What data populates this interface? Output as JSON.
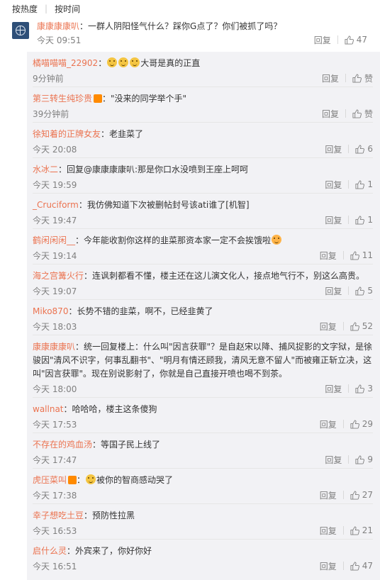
{
  "tabs": {
    "hot": "按热度",
    "time": "按时间"
  },
  "main": {
    "user": "康康康康叭",
    "text": "：一群人阴阳怪气什么？踩你G点了？你们被抓了吗？",
    "time": "今天 09:51",
    "reply_label": "回复",
    "likes": "47"
  },
  "replies": [
    {
      "user": "橘喵喵喵_22902",
      "emojis": 3,
      "text": "大哥是真的正直",
      "time": "9分钟前",
      "reply_label": "回复",
      "likes": "赞"
    },
    {
      "user": "第三转生纯珍贵",
      "badge": true,
      "text": "：\"没来的同学举个手\"",
      "time": "39分钟前",
      "reply_label": "回复",
      "likes": "赞"
    },
    {
      "user": "徐知着的正牌女友",
      "text": "：老韭菜了",
      "time": "今天 20:08",
      "reply_label": "回复",
      "likes": "6"
    },
    {
      "user": "水冰二",
      "text": "：回复@康康康康叭:那是你口水没喷到王座上呵呵",
      "time": "今天 19:59",
      "reply_label": "回复",
      "likes": "1"
    },
    {
      "user": "_Cruciform",
      "text": "：我仿佛知道下次被删帖封号该ati谁了[机智]",
      "time": "今天 19:47",
      "reply_label": "回复",
      "likes": "1"
    },
    {
      "user": "鹤闲闲闲__",
      "text": "：今年能收割你这样的韭菜那资本家一定不会挨饿啦",
      "emoji_after": true,
      "time": "今天 19:14",
      "reply_label": "回复",
      "likes": "11"
    },
    {
      "user": "海之宫篝火行",
      "text": "：连讽刺都看不懂，楼主还在这儿演文化人，接点地气行不，别这么高贵。",
      "time": "今天 19:07",
      "reply_label": "回复",
      "likes": "5"
    },
    {
      "user": "Miko870",
      "text": "：长势不错的韭菜，啊不，已经韭黄了",
      "time": "今天 18:03",
      "reply_label": "回复",
      "likes": "52"
    },
    {
      "user": "康康康康叭",
      "text": "：统一回复楼上：什么叫\"因言获罪\"？是自赵宋以降、捕风捉影的文字狱，是徐骏因\"清风不识字，何事乱翻书\"、\"明月有情还顾我，清风无意不留人\"而被雍正斩立决，这叫\"因言获罪\"。现在别说影射了，你就是自己直接开喷也喝不到茶。",
      "time": "今天 18:00",
      "reply_label": "回复",
      "likes": "3"
    },
    {
      "user": "wallnat",
      "text": "：哈哈哈，楼主这条傻狗",
      "time": "今天 17:53",
      "reply_label": "回复",
      "likes": "29"
    },
    {
      "user": "不存在的鸡血汤",
      "text": "：等国子民上线了",
      "time": "今天 17:47",
      "reply_label": "回复",
      "likes": "9"
    },
    {
      "user": "虎压菜叫",
      "badge": true,
      "emoji_before": true,
      "text": "被你的智商感动哭了",
      "time": "今天 17:38",
      "reply_label": "回复",
      "likes": "27"
    },
    {
      "user": "幸子想吃土豆",
      "text": "：预防性拉黑",
      "time": "今天 16:53",
      "reply_label": "回复",
      "likes": "21"
    },
    {
      "user": "启什么灵",
      "text": "：外宾来了，你好你好",
      "time": "今天 16:51",
      "reply_label": "回复",
      "likes": "47"
    }
  ]
}
